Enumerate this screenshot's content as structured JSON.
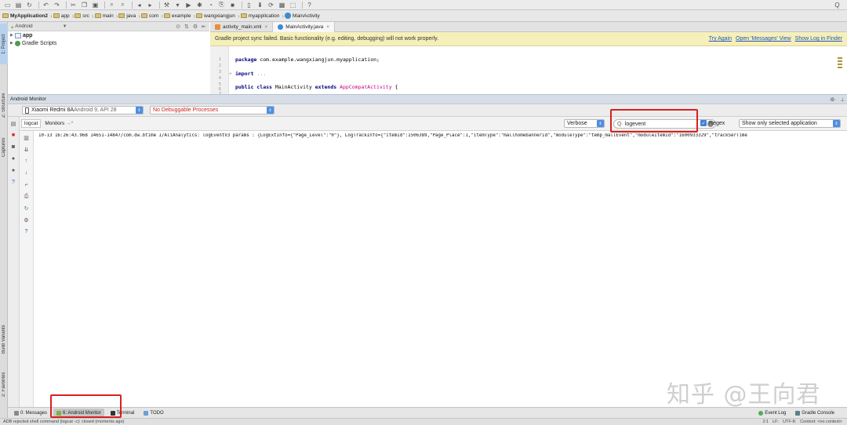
{
  "toolbar": {
    "help_icon": "?",
    "search_icon": "Q"
  },
  "breadcrumbs": [
    "MyApplication2",
    "app",
    "src",
    "main",
    "java",
    "com",
    "example",
    "wangxiangjun",
    "myapplication",
    "MainActivity"
  ],
  "left_stripe": {
    "project": "1: Project",
    "structure": "Z: Structure",
    "captures": "Captures",
    "build_variants": "Build Variants",
    "favorites": "2: Favorites"
  },
  "project_panel": {
    "view_selector": "Android",
    "tree": [
      "app",
      "Gradle Scripts"
    ]
  },
  "editor": {
    "tabs": [
      {
        "label": "activity_main.xml",
        "active": false
      },
      {
        "label": "MainActivity.java",
        "active": true
      }
    ],
    "banner": {
      "message": "Gradle project sync failed. Basic functionality (e.g. editing, debugging) will not work properly.",
      "links": [
        "Try Again",
        "Open 'Messages' View",
        "Show Log in Finder"
      ]
    },
    "line_numbers": [
      "1",
      "2",
      "3",
      "4",
      "5",
      "6",
      "7"
    ],
    "code": {
      "line1_kw": "package",
      "line1_rest": " com.example.wangxiangjun.myapplication;",
      "line3_kw": "import",
      "line3_fold": " ...",
      "line6_kw1": "public class",
      "line6_name": " MainActivity ",
      "line6_kw2": "extends",
      "line6_ref": " AppCompatActivity",
      "line6_end": " {"
    }
  },
  "monitor": {
    "title": "Android Monitor",
    "device": "Xiaomi Redmi 8A",
    "device_detail": " Android 9, API 28",
    "process": "No Debuggable Processes",
    "tabs": [
      {
        "label": "logcat",
        "active": true
      },
      {
        "label": "Monitors",
        "active": false
      }
    ],
    "log_level": "Verbose",
    "filter_value": "logevent",
    "regex_label": "Regex",
    "scope": "Show only selected application",
    "log_lines": [
      "10-13 16:26:43.968 14651-14847/com.dw.btime I/AliAnalytics: logEventV3 params : {LogExtInfo={\"Page_Level\":\"0\"}, LogTrackInfo={\"itemId\":1506389,\"Page_Place\":1,\"itemType\":\"mallhomebannerId\",\"moduleType\":\"temp_mallEvent\",\"moduleItemId\":\"1600933329\",\"trackSerTime"
    ]
  },
  "watermark": "知乎 @王向君",
  "bottom_tabs": [
    {
      "label": "0: Messages",
      "active": false
    },
    {
      "label": "6: Android Monitor",
      "active": true
    },
    {
      "label": "Terminal",
      "active": false
    },
    {
      "label": "TODO",
      "active": false
    }
  ],
  "bottom_right": [
    "Event Log",
    "Gradle Console"
  ],
  "status": {
    "message": "ADB rejected shell command (logcat -c): closed (moments ago)",
    "position": "2:1",
    "line_sep": "LF:",
    "encoding": "UTF-8:",
    "context": "Context: <no context>"
  },
  "colors": {
    "accent": "#3f82d8",
    "highlight_box": "#d9201f",
    "banner": "#f5efb9"
  }
}
